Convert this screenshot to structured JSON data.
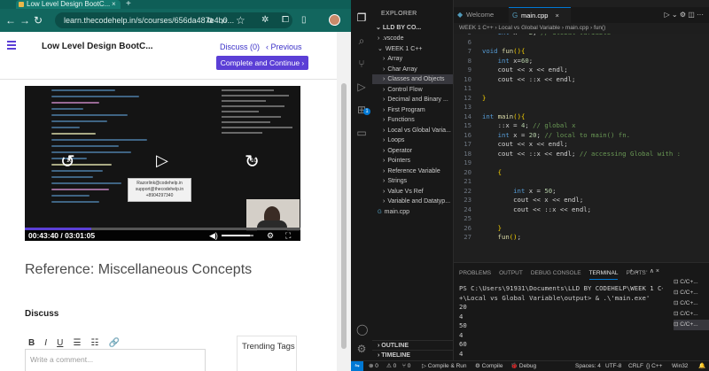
{
  "browser": {
    "tab_title": "Low Level Design BootC...",
    "tab_close": "×",
    "new_tab": "+",
    "url": "learn.thecodehelp.in/s/courses/656da487e4b0...",
    "course_title": "Low Level Design BootC...",
    "discuss_label": "Discuss (0)",
    "previous_label": "‹  Previous",
    "complete_label": "Complete and Continue  ›",
    "video": {
      "time_label": "00:43:40 / 03:01:05",
      "caption_lines": [
        "Razorlink@codehelp.in",
        "support@thecodehelp.in",
        "+8904297340"
      ],
      "rewind_label": "10",
      "forward_label": "10",
      "progress": 0.24,
      "volume": 0.9
    },
    "reference_heading": "Reference: Miscellaneous Concepts",
    "discuss_heading": "Discuss",
    "editor_tools": [
      "B",
      "I",
      "U",
      "☰",
      "☷",
      "🔗"
    ],
    "comment_placeholder": "Write a comment...",
    "trending_tags": "Trending Tags"
  },
  "vscode": {
    "explorer_title": "EXPLORER",
    "root_folder": "LLD BY CO...",
    "tree": [
      {
        "label": ".vscode",
        "kind": "folder",
        "depth": 1
      },
      {
        "label": "WEEK 1 C++",
        "kind": "folder-open",
        "depth": 1
      },
      {
        "label": "Array",
        "kind": "folder",
        "depth": 2
      },
      {
        "label": "Char Array",
        "kind": "folder",
        "depth": 2
      },
      {
        "label": "Classes and Objects",
        "kind": "folder",
        "depth": 2,
        "selected": true
      },
      {
        "label": "Control Flow",
        "kind": "folder",
        "depth": 2
      },
      {
        "label": "Decimal and Binary ...",
        "kind": "folder",
        "depth": 2
      },
      {
        "label": "First Program",
        "kind": "folder",
        "depth": 2
      },
      {
        "label": "Functions",
        "kind": "folder",
        "depth": 2
      },
      {
        "label": "Local vs Global Varia...",
        "kind": "folder",
        "depth": 2
      },
      {
        "label": "Loops",
        "kind": "folder",
        "depth": 2
      },
      {
        "label": "Operator",
        "kind": "folder",
        "depth": 2
      },
      {
        "label": "Pointers",
        "kind": "folder",
        "depth": 2
      },
      {
        "label": "Reference Variable",
        "kind": "folder",
        "depth": 2
      },
      {
        "label": "Strings",
        "kind": "folder",
        "depth": 2
      },
      {
        "label": "Value Vs Ref",
        "kind": "folder",
        "depth": 2
      },
      {
        "label": "Variable and Datatyp...",
        "kind": "folder",
        "depth": 2
      },
      {
        "label": "main.cpp",
        "kind": "file",
        "depth": 1
      }
    ],
    "outline_label": "OUTLINE",
    "timeline_label": "TIMELINE",
    "tabs": [
      {
        "label": "Welcome",
        "active": false
      },
      {
        "label": "main.cpp",
        "active": true
      }
    ],
    "breadcrumb": "WEEK 1 C++  ›  Local vs Global Variable  ›  main.cpp  ›  fun()",
    "code_lines": [
      {
        "n": "5",
        "html": "    <span class='kw'>int</span> x = <span class='num'>2</span>; <span class='cm'>// Global variable</span>"
      },
      {
        "n": "6",
        "html": ""
      },
      {
        "n": "7",
        "html": "<span class='kw'>void</span> <span class='fn'>fun</span><span class='br'>()</span><span class='br'>{</span>"
      },
      {
        "n": "8",
        "html": "    <span class='kw'>int</span> x=<span class='num'>60</span>;"
      },
      {
        "n": "9",
        "html": "    cout &lt;&lt; x &lt;&lt; endl;"
      },
      {
        "n": "10",
        "html": "    cout &lt;&lt; ::x &lt;&lt; endl;"
      },
      {
        "n": "11",
        "html": ""
      },
      {
        "n": "12",
        "html": "<span class='br'>}</span>"
      },
      {
        "n": "13",
        "html": ""
      },
      {
        "n": "14",
        "html": "<span class='kw'>int</span> <span class='fn'>main</span><span class='br'>()</span><span class='br'>{</span>"
      },
      {
        "n": "15",
        "html": "    ::x = <span class='num'>4</span>; <span class='cm'>// global x</span>"
      },
      {
        "n": "16",
        "html": "    <span class='kw'>int</span> x = <span class='num'>20</span>; <span class='cm'>// local to main() fn.</span>"
      },
      {
        "n": "17",
        "html": "    cout &lt;&lt; x &lt;&lt; endl;"
      },
      {
        "n": "18",
        "html": "    cout &lt;&lt; ::x &lt;&lt; endl; <span class='cm'>// accessing Global with :</span>"
      },
      {
        "n": "19",
        "html": ""
      },
      {
        "n": "20",
        "html": "    <span class='br'>{</span>"
      },
      {
        "n": "21",
        "html": ""
      },
      {
        "n": "22",
        "html": "        <span class='kw'>int</span> x = <span class='num'>50</span>;"
      },
      {
        "n": "23",
        "html": "        cout &lt;&lt; x &lt;&lt; endl;"
      },
      {
        "n": "24",
        "html": "        cout &lt;&lt; ::x &lt;&lt; endl;"
      },
      {
        "n": "25",
        "html": ""
      },
      {
        "n": "26",
        "html": "    <span class='br'>}</span>"
      },
      {
        "n": "27",
        "html": "    <span class='fn'>fun</span><span class='br'>()</span>;"
      }
    ],
    "panel_tabs": [
      "PROBLEMS",
      "OUTPUT",
      "DEBUG CONSOLE",
      "TERMINAL",
      "PORTS"
    ],
    "active_panel_tab": "TERMINAL",
    "terminal_lines": [
      "PS C:\\Users\\91931\\Documents\\LLD BY CODEHELP\\WEEK 1 C+",
      "+\\Local vs Global Variable\\output> & .\\'main.exe'",
      "20",
      "4",
      "50",
      "4",
      "60",
      "4",
      "PS C:\\Users\\91931\\Documents\\LLD BY CODEHELP\\WEEK 1 C+",
      "+\\Local vs Global Variable\\output> "
    ],
    "terminal_instances": [
      "C/C+...",
      "C/C+...",
      "C/C+...",
      "C/C+...",
      "C/C+..."
    ],
    "status": {
      "errors": "⊗ 0",
      "warnings": "⚠ 0",
      "ports": "⑂ 0",
      "compile_run": "▷ Compile & Run",
      "compile": "⚙ Compile",
      "debug": "🐞 Debug",
      "spaces": "Spaces: 4",
      "encoding": "UTF-8",
      "eol": "CRLF",
      "lang": "{} C++",
      "platform": "Win32"
    }
  }
}
